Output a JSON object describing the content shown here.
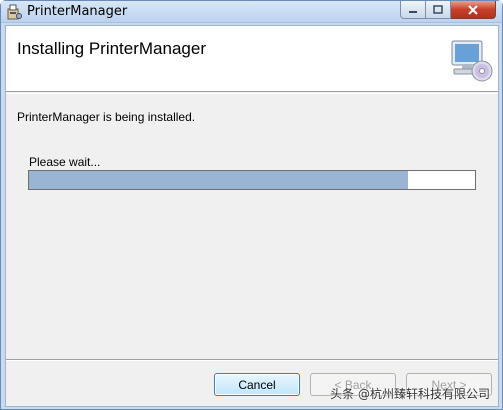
{
  "window": {
    "title": "PrinterManager",
    "accent_color": "#9ab4d3"
  },
  "banner": {
    "title": "Installing PrinterManager",
    "icon": "computer-cd-icon"
  },
  "content": {
    "status": "PrinterManager is being installed.",
    "wait_label": "Please wait...",
    "progress_fraction": 0.85
  },
  "buttons": {
    "cancel": "Cancel",
    "back": "< Back",
    "next": "Next >"
  },
  "watermark": "头条 @杭州臻轩科技有限公司"
}
